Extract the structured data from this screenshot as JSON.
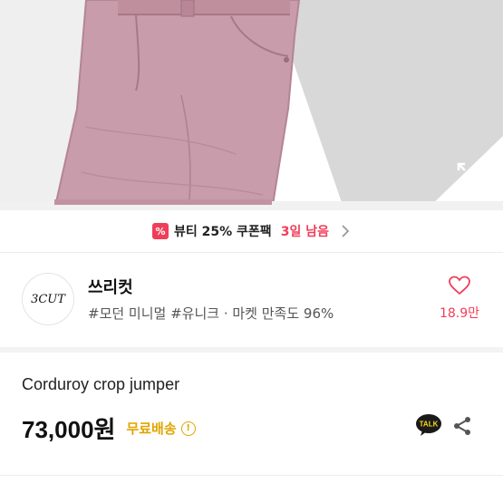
{
  "coupon": {
    "badge": "%",
    "text": "뷰티 25% 쿠폰팩",
    "highlight": "3일 남음"
  },
  "shop": {
    "logo_text": "3CUT",
    "name": "쓰리컷",
    "tags": "#모던 미니멀 #유니크 · 마켓 만족도 96%",
    "favorites": "18.9만"
  },
  "product": {
    "name": "Corduroy crop jumper",
    "price": "73,000원",
    "shipping": "무료배송",
    "info_symbol": "!"
  },
  "actions": {
    "talk_label": "TALK"
  },
  "colors": {
    "accent_pink": "#f03e5a",
    "shipping_yellow": "#e0a500",
    "jeans_pink": "#c79aa8"
  }
}
